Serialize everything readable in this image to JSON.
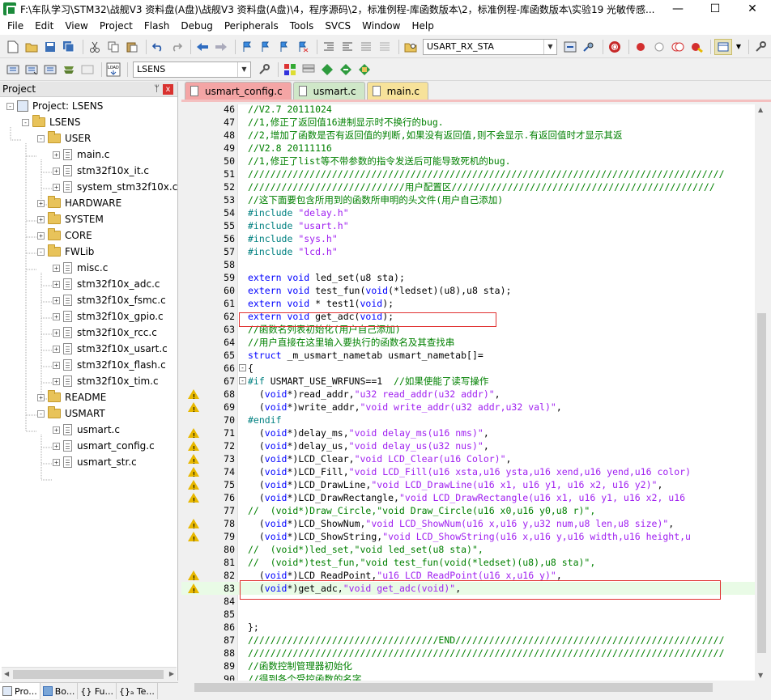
{
  "window": {
    "title": "F:\\车队学习\\STM32\\战舰V3 资料盘(A盘)\\战舰V3 资料盘(A盘)\\4，程序源码\\2，标准例程-库函数版本\\2，标准例程-库函数版本\\实验19 光敏传感...",
    "min": "—",
    "max": "☐",
    "close": "✕"
  },
  "menu": [
    "File",
    "Edit",
    "View",
    "Project",
    "Flash",
    "Debug",
    "Peripherals",
    "Tools",
    "SVCS",
    "Window",
    "Help"
  ],
  "toolbar": {
    "find_combo": "USART_RX_STA",
    "target_combo": "LSENS"
  },
  "project_panel": {
    "title": "Project",
    "pin": "ᛘ",
    "close": "x",
    "tree": [
      {
        "label": "Project: LSENS",
        "level": 0,
        "type": "project",
        "expander": "-"
      },
      {
        "label": "LSENS",
        "level": 1,
        "type": "target",
        "expander": "-"
      },
      {
        "label": "USER",
        "level": 2,
        "type": "folder",
        "expander": "-"
      },
      {
        "label": "main.c",
        "level": 3,
        "type": "file",
        "expander": "+"
      },
      {
        "label": "stm32f10x_it.c",
        "level": 3,
        "type": "file",
        "expander": "+"
      },
      {
        "label": "system_stm32f10x.c",
        "level": 3,
        "type": "file",
        "expander": "+"
      },
      {
        "label": "HARDWARE",
        "level": 2,
        "type": "folder",
        "expander": "+"
      },
      {
        "label": "SYSTEM",
        "level": 2,
        "type": "folder",
        "expander": "+"
      },
      {
        "label": "CORE",
        "level": 2,
        "type": "folder",
        "expander": "+"
      },
      {
        "label": "FWLib",
        "level": 2,
        "type": "folder",
        "expander": "-"
      },
      {
        "label": "misc.c",
        "level": 3,
        "type": "file",
        "expander": "+"
      },
      {
        "label": "stm32f10x_adc.c",
        "level": 3,
        "type": "file",
        "expander": "+"
      },
      {
        "label": "stm32f10x_fsmc.c",
        "level": 3,
        "type": "file",
        "expander": "+"
      },
      {
        "label": "stm32f10x_gpio.c",
        "level": 3,
        "type": "file",
        "expander": "+"
      },
      {
        "label": "stm32f10x_rcc.c",
        "level": 3,
        "type": "file",
        "expander": "+"
      },
      {
        "label": "stm32f10x_usart.c",
        "level": 3,
        "type": "file",
        "expander": "+"
      },
      {
        "label": "stm32f10x_flash.c",
        "level": 3,
        "type": "file",
        "expander": "+"
      },
      {
        "label": "stm32f10x_tim.c",
        "level": 3,
        "type": "file",
        "expander": "+"
      },
      {
        "label": "README",
        "level": 2,
        "type": "folder",
        "expander": "+"
      },
      {
        "label": "USMART",
        "level": 2,
        "type": "folder",
        "expander": "-"
      },
      {
        "label": "usmart.c",
        "level": 3,
        "type": "file",
        "expander": "+"
      },
      {
        "label": "usmart_config.c",
        "level": 3,
        "type": "file",
        "expander": "+"
      },
      {
        "label": "usmart_str.c",
        "level": 3,
        "type": "file",
        "expander": "+"
      }
    ]
  },
  "bottom_tabs": [
    "Pro...",
    "Bo...",
    "{} Fu...",
    "{}ₐ Te..."
  ],
  "editor_tabs": [
    {
      "label": "usmart_config.c",
      "color": "#f4a5a5"
    },
    {
      "label": "usmart.c",
      "color": "#cfe7c8"
    },
    {
      "label": "main.c",
      "color": "#f7e29a"
    }
  ],
  "code_lines": [
    {
      "n": "46",
      "warn": false,
      "fold": "",
      "hl": false,
      "segs": [
        [
          "c-com",
          "//V2.7 20111024"
        ]
      ]
    },
    {
      "n": "47",
      "warn": false,
      "fold": "",
      "hl": false,
      "segs": [
        [
          "c-com",
          "//1,修正了返回值16进制显示时不换行的bug."
        ]
      ]
    },
    {
      "n": "48",
      "warn": false,
      "fold": "",
      "hl": false,
      "segs": [
        [
          "c-com",
          "//2,增加了函数是否有返回值的判断,如果没有返回值,则不会显示.有返回值时才显示其返"
        ]
      ]
    },
    {
      "n": "49",
      "warn": false,
      "fold": "",
      "hl": false,
      "segs": [
        [
          "c-com",
          "//V2.8 20111116"
        ]
      ]
    },
    {
      "n": "50",
      "warn": false,
      "fold": "",
      "hl": false,
      "segs": [
        [
          "c-com",
          "//1,修正了list等不带参数的指令发送后可能导致死机的bug."
        ]
      ]
    },
    {
      "n": "51",
      "warn": false,
      "fold": "",
      "hl": false,
      "segs": [
        [
          "c-com",
          "/////////////////////////////////////////////////////////////////////////////////////"
        ]
      ]
    },
    {
      "n": "52",
      "warn": false,
      "fold": "",
      "hl": false,
      "segs": [
        [
          "c-com",
          "////////////////////////////用户配置区///////////////////////////////////////////////"
        ]
      ]
    },
    {
      "n": "53",
      "warn": false,
      "fold": "",
      "hl": false,
      "segs": [
        [
          "c-com",
          "//这下面要包含所用到的函数所申明的头文件(用户自己添加)"
        ]
      ]
    },
    {
      "n": "54",
      "warn": false,
      "fold": "",
      "hl": false,
      "segs": [
        [
          "c-pp",
          "#include "
        ],
        [
          "c-str",
          "\"delay.h\""
        ]
      ]
    },
    {
      "n": "55",
      "warn": false,
      "fold": "",
      "hl": false,
      "segs": [
        [
          "c-pp",
          "#include "
        ],
        [
          "c-str",
          "\"usart.h\""
        ]
      ]
    },
    {
      "n": "56",
      "warn": false,
      "fold": "",
      "hl": false,
      "segs": [
        [
          "c-pp",
          "#include "
        ],
        [
          "c-str",
          "\"sys.h\""
        ]
      ]
    },
    {
      "n": "57",
      "warn": false,
      "fold": "",
      "hl": false,
      "segs": [
        [
          "c-pp",
          "#include "
        ],
        [
          "c-str",
          "\"lcd.h\""
        ]
      ]
    },
    {
      "n": "58",
      "warn": false,
      "fold": "",
      "hl": false,
      "segs": []
    },
    {
      "n": "59",
      "warn": false,
      "fold": "",
      "hl": false,
      "segs": [
        [
          "c-kw",
          "extern void "
        ],
        [
          "c-txt",
          "led_set(u8 sta);"
        ]
      ]
    },
    {
      "n": "60",
      "warn": false,
      "fold": "",
      "hl": false,
      "segs": [
        [
          "c-kw",
          "extern void "
        ],
        [
          "c-txt",
          "test_fun("
        ],
        [
          "c-kw",
          "void"
        ],
        [
          "c-txt",
          "(*ledset)(u8),u8 sta);"
        ]
      ]
    },
    {
      "n": "61",
      "warn": false,
      "fold": "",
      "hl": false,
      "segs": [
        [
          "c-kw",
          "extern void "
        ],
        [
          "c-txt",
          "* test1("
        ],
        [
          "c-kw",
          "void"
        ],
        [
          "c-txt",
          ");"
        ]
      ]
    },
    {
      "n": "62",
      "warn": false,
      "fold": "",
      "hl": false,
      "segs": [
        [
          "c-kw",
          "extern void "
        ],
        [
          "c-txt",
          "get_adc("
        ],
        [
          "c-kw",
          "void"
        ],
        [
          "c-txt",
          ");"
        ]
      ]
    },
    {
      "n": "63",
      "warn": false,
      "fold": "",
      "hl": false,
      "segs": [
        [
          "c-com",
          "//函数名列表初始化(用户自己添加)"
        ]
      ]
    },
    {
      "n": "64",
      "warn": false,
      "fold": "",
      "hl": false,
      "segs": [
        [
          "c-com",
          "//用户直接在这里输入要执行的函数名及其查找串"
        ]
      ]
    },
    {
      "n": "65",
      "warn": false,
      "fold": "",
      "hl": false,
      "segs": [
        [
          "c-kw",
          "struct "
        ],
        [
          "c-txt",
          "_m_usmart_nametab usmart_nametab[]="
        ]
      ]
    },
    {
      "n": "66",
      "warn": false,
      "fold": "-",
      "hl": false,
      "segs": [
        [
          "c-txt",
          "{"
        ]
      ]
    },
    {
      "n": "67",
      "warn": false,
      "fold": "-",
      "hl": false,
      "segs": [
        [
          "c-pp",
          "#if "
        ],
        [
          "c-txt",
          "USMART_USE_WRFUNS==1  "
        ],
        [
          "c-com",
          "//如果使能了读写操作"
        ]
      ]
    },
    {
      "n": "68",
      "warn": true,
      "fold": "",
      "hl": false,
      "segs": [
        [
          "c-txt",
          "  ("
        ],
        [
          "c-kw",
          "void"
        ],
        [
          "c-txt",
          "*)read_addr,"
        ],
        [
          "c-str",
          "\"u32 read_addr(u32 addr)\""
        ],
        [
          "c-txt",
          ","
        ]
      ]
    },
    {
      "n": "69",
      "warn": true,
      "fold": "",
      "hl": false,
      "segs": [
        [
          "c-txt",
          "  ("
        ],
        [
          "c-kw",
          "void"
        ],
        [
          "c-txt",
          "*)write_addr,"
        ],
        [
          "c-str",
          "\"void write_addr(u32 addr,u32 val)\""
        ],
        [
          "c-txt",
          ","
        ]
      ]
    },
    {
      "n": "70",
      "warn": false,
      "fold": "",
      "hl": false,
      "segs": [
        [
          "c-pp",
          "#endif"
        ]
      ]
    },
    {
      "n": "71",
      "warn": true,
      "fold": "",
      "hl": false,
      "segs": [
        [
          "c-txt",
          "  ("
        ],
        [
          "c-kw",
          "void"
        ],
        [
          "c-txt",
          "*)delay_ms,"
        ],
        [
          "c-str",
          "\"void delay_ms(u16 nms)\""
        ],
        [
          "c-txt",
          ","
        ]
      ]
    },
    {
      "n": "72",
      "warn": true,
      "fold": "",
      "hl": false,
      "segs": [
        [
          "c-txt",
          "  ("
        ],
        [
          "c-kw",
          "void"
        ],
        [
          "c-txt",
          "*)delay_us,"
        ],
        [
          "c-str",
          "\"void delay_us(u32 nus)\""
        ],
        [
          "c-txt",
          ","
        ]
      ]
    },
    {
      "n": "73",
      "warn": true,
      "fold": "",
      "hl": false,
      "segs": [
        [
          "c-txt",
          "  ("
        ],
        [
          "c-kw",
          "void"
        ],
        [
          "c-txt",
          "*)LCD_Clear,"
        ],
        [
          "c-str",
          "\"void LCD_Clear(u16 Color)\""
        ],
        [
          "c-txt",
          ","
        ]
      ]
    },
    {
      "n": "74",
      "warn": true,
      "fold": "",
      "hl": false,
      "segs": [
        [
          "c-txt",
          "  ("
        ],
        [
          "c-kw",
          "void"
        ],
        [
          "c-txt",
          "*)LCD_Fill,"
        ],
        [
          "c-str",
          "\"void LCD_Fill(u16 xsta,u16 ysta,u16 xend,u16 yend,u16 color)"
        ]
      ]
    },
    {
      "n": "75",
      "warn": true,
      "fold": "",
      "hl": false,
      "segs": [
        [
          "c-txt",
          "  ("
        ],
        [
          "c-kw",
          "void"
        ],
        [
          "c-txt",
          "*)LCD_DrawLine,"
        ],
        [
          "c-str",
          "\"void LCD_DrawLine(u16 x1, u16 y1, u16 x2, u16 y2)\""
        ],
        [
          "c-txt",
          ","
        ]
      ]
    },
    {
      "n": "76",
      "warn": true,
      "fold": "",
      "hl": false,
      "segs": [
        [
          "c-txt",
          "  ("
        ],
        [
          "c-kw",
          "void"
        ],
        [
          "c-txt",
          "*)LCD_DrawRectangle,"
        ],
        [
          "c-str",
          "\"void LCD_DrawRectangle(u16 x1, u16 y1, u16 x2, u16"
        ]
      ]
    },
    {
      "n": "77",
      "warn": false,
      "fold": "",
      "hl": false,
      "segs": [
        [
          "c-com",
          "//  (void*)Draw_Circle,\"void Draw_Circle(u16 x0,u16 y0,u8 r)\","
        ]
      ]
    },
    {
      "n": "78",
      "warn": true,
      "fold": "",
      "hl": false,
      "segs": [
        [
          "c-txt",
          "  ("
        ],
        [
          "c-kw",
          "void"
        ],
        [
          "c-txt",
          "*)LCD_ShowNum,"
        ],
        [
          "c-str",
          "\"void LCD_ShowNum(u16 x,u16 y,u32 num,u8 len,u8 size)\""
        ],
        [
          "c-txt",
          ","
        ]
      ]
    },
    {
      "n": "79",
      "warn": true,
      "fold": "",
      "hl": false,
      "segs": [
        [
          "c-txt",
          "  ("
        ],
        [
          "c-kw",
          "void"
        ],
        [
          "c-txt",
          "*)LCD_ShowString,"
        ],
        [
          "c-str",
          "\"void LCD_ShowString(u16 x,u16 y,u16 width,u16 height,u"
        ]
      ]
    },
    {
      "n": "80",
      "warn": false,
      "fold": "",
      "hl": false,
      "segs": [
        [
          "c-com",
          "//  (void*)led_set,\"void led_set(u8 sta)\","
        ]
      ]
    },
    {
      "n": "81",
      "warn": false,
      "fold": "",
      "hl": false,
      "segs": [
        [
          "c-com",
          "//  (void*)test_fun,\"void test_fun(void(*ledset)(u8),u8 sta)\","
        ]
      ]
    },
    {
      "n": "82",
      "warn": true,
      "fold": "",
      "hl": false,
      "segs": [
        [
          "c-txt",
          "  ("
        ],
        [
          "c-kw",
          "void"
        ],
        [
          "c-txt",
          "*)LCD_ReadPoint,"
        ],
        [
          "c-str",
          "\"u16 LCD_ReadPoint(u16 x,u16 y)\""
        ],
        [
          "c-txt",
          ","
        ]
      ]
    },
    {
      "n": "83",
      "warn": true,
      "fold": "",
      "hl": true,
      "segs": [
        [
          "c-txt",
          "  ("
        ],
        [
          "c-kw",
          "void"
        ],
        [
          "c-txt",
          "*)get_adc,"
        ],
        [
          "c-str",
          "\"void get_adc(void)\""
        ],
        [
          "c-txt",
          ","
        ]
      ]
    },
    {
      "n": "84",
      "warn": false,
      "fold": "",
      "hl": false,
      "segs": []
    },
    {
      "n": "85",
      "warn": false,
      "fold": "",
      "hl": false,
      "segs": []
    },
    {
      "n": "86",
      "warn": false,
      "fold": "",
      "hl": false,
      "segs": [
        [
          "c-txt",
          "};"
        ]
      ]
    },
    {
      "n": "87",
      "warn": false,
      "fold": "",
      "hl": false,
      "segs": [
        [
          "c-com",
          "//////////////////////////////////END////////////////////////////////////////////////"
        ]
      ]
    },
    {
      "n": "88",
      "warn": false,
      "fold": "",
      "hl": false,
      "segs": [
        [
          "c-com",
          "/////////////////////////////////////////////////////////////////////////////////////"
        ]
      ]
    },
    {
      "n": "89",
      "warn": false,
      "fold": "",
      "hl": false,
      "segs": [
        [
          "c-com",
          "//函数控制管理器初始化"
        ]
      ]
    },
    {
      "n": "90",
      "warn": false,
      "fold": "",
      "hl": false,
      "segs": [
        [
          "c-com",
          "//得到各个受控函数的名字"
        ]
      ]
    }
  ]
}
